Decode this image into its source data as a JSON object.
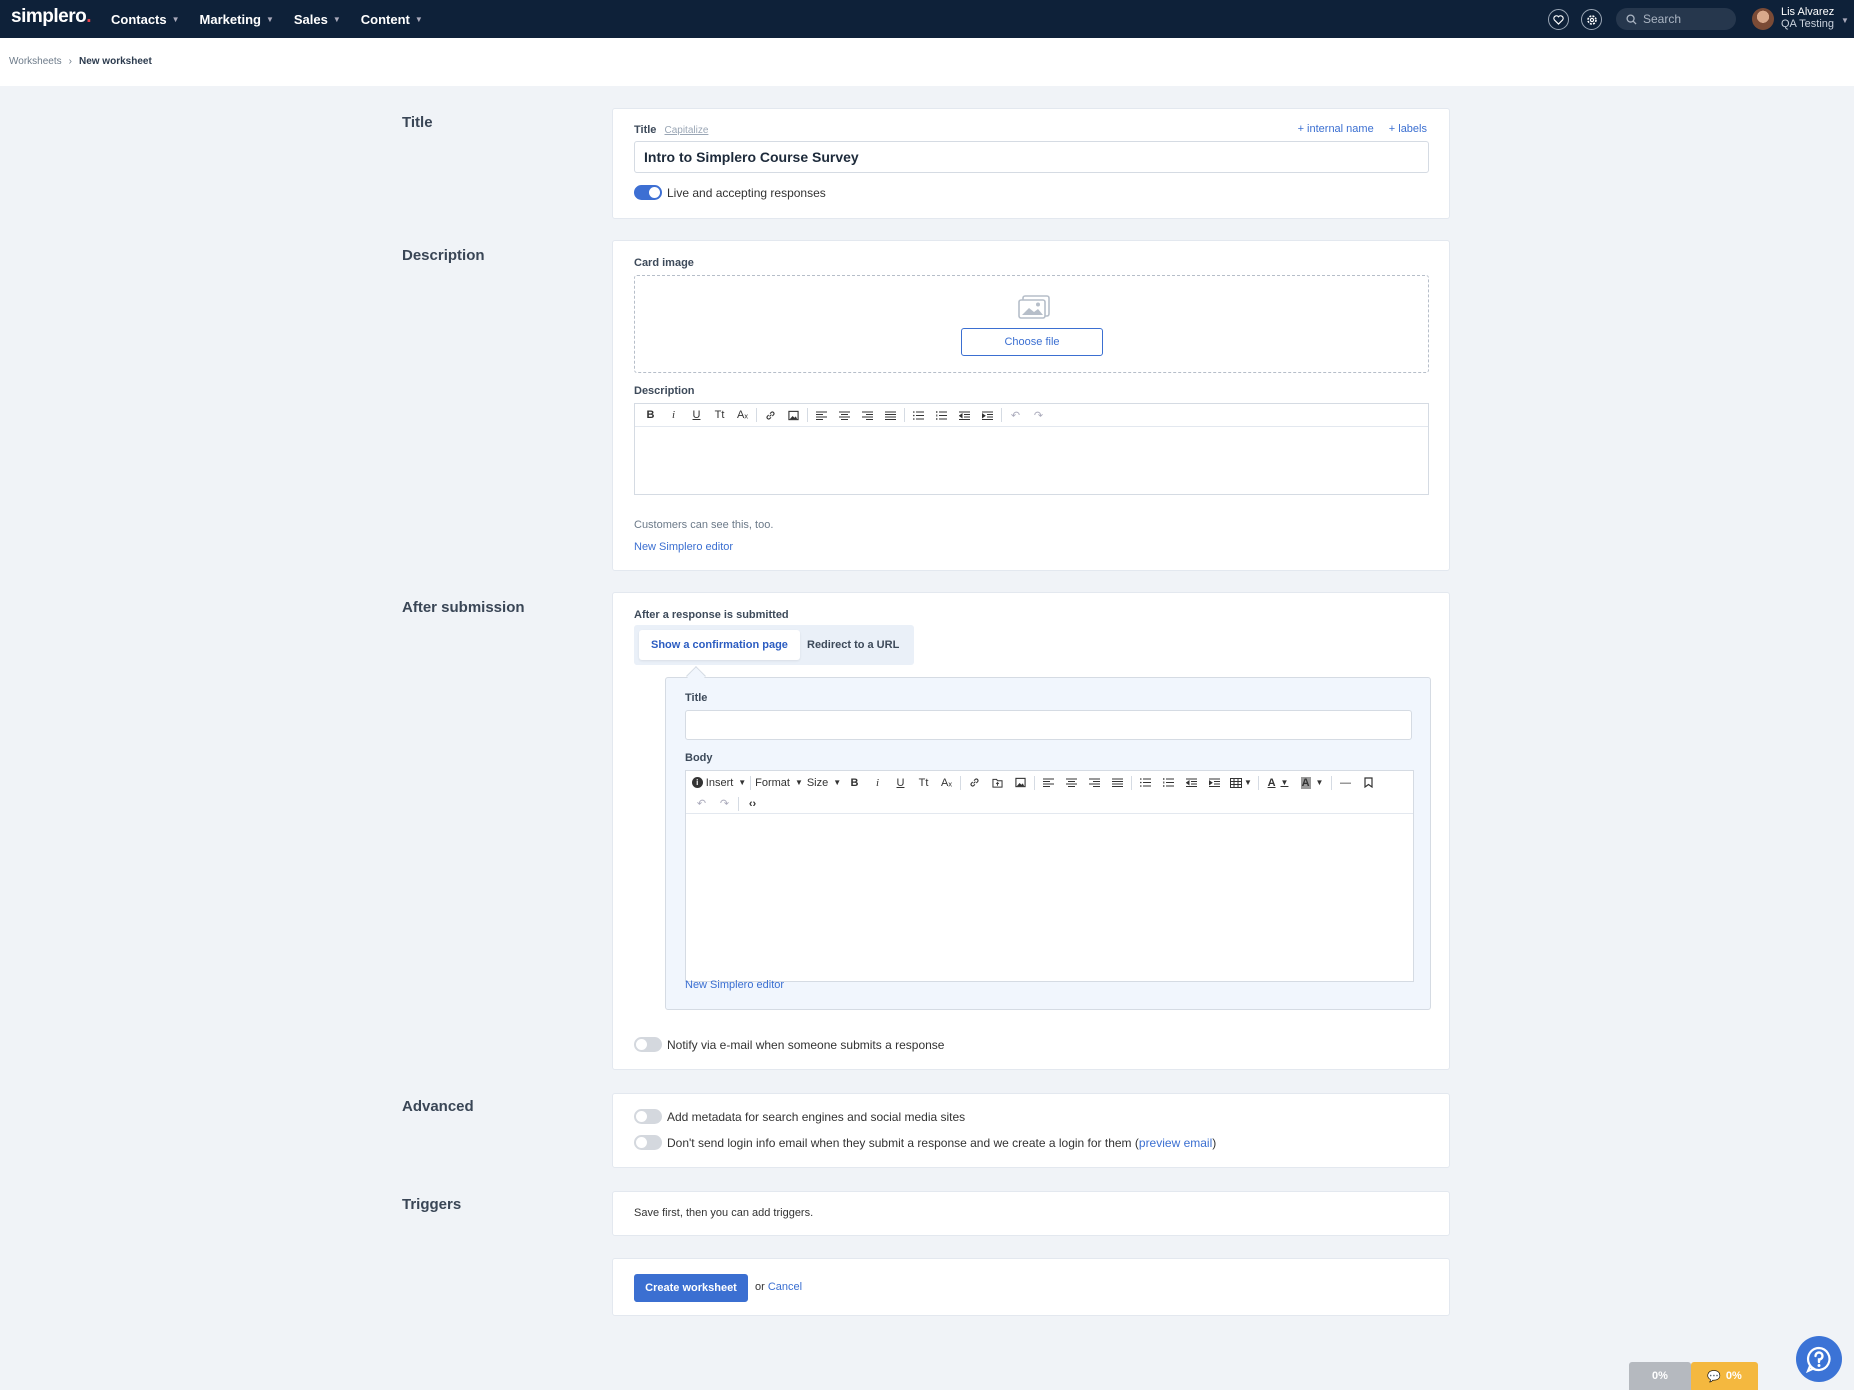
{
  "brand": {
    "name": "simplero",
    "dot": "."
  },
  "nav": [
    {
      "label": "Contacts"
    },
    {
      "label": "Marketing"
    },
    {
      "label": "Sales"
    },
    {
      "label": "Content"
    }
  ],
  "search": {
    "placeholder": "Search"
  },
  "user": {
    "name": "Lis Alvarez",
    "org": "QA Testing"
  },
  "breadcrumb": {
    "parent": "Worksheets",
    "current": "New worksheet"
  },
  "sections": {
    "title": "Title",
    "description": "Description",
    "after_submission": "After submission",
    "advanced": "Advanced",
    "triggers": "Triggers"
  },
  "title_card": {
    "label": "Title",
    "capitalize": "Capitalize",
    "internal_name": "+ internal name",
    "labels": "+ labels",
    "value": "Intro to Simplero Course Survey",
    "live_label": "Live and accepting responses",
    "live_on": true
  },
  "description_card": {
    "card_image_label": "Card image",
    "choose_file": "Choose file",
    "description_label": "Description",
    "hint": "Customers can see this, too.",
    "new_editor": "New Simplero editor",
    "toolbar": {
      "bold": "B",
      "italic": "i",
      "underline": "U",
      "size": "Tt",
      "clear": "Aₓ"
    }
  },
  "after_submission_card": {
    "label": "After a response is submitted",
    "tab_confirm": "Show a confirmation page",
    "tab_redirect": "Redirect to a URL",
    "confirm_title_label": "Title",
    "confirm_title_value": "",
    "body_label": "Body",
    "toolbar": {
      "insert": "Insert",
      "format": "Format",
      "size": "Size",
      "bold": "B",
      "italic": "i",
      "underline": "U",
      "tt": "Tt",
      "clear": "Aₓ"
    },
    "new_editor": "New Simplero editor",
    "notify_label": "Notify via e-mail when someone submits a response"
  },
  "advanced_card": {
    "metadata_label": "Add metadata for search engines and social media sites",
    "login_label_pre": "Don't send login info email when they submit a response and we create a login for them (",
    "login_link": "preview email",
    "login_label_post": ")"
  },
  "triggers_card": {
    "text": "Save first, then you can add triggers."
  },
  "actions": {
    "create": "Create worksheet",
    "or": "or",
    "cancel": "Cancel"
  },
  "badges": {
    "progress_a": "0%",
    "progress_b": "0%"
  },
  "colors": {
    "topbar": "#0e2139",
    "accent": "#3b6fd1",
    "badge_gray": "#b5b9bf",
    "badge_yellow": "#f4b83f"
  }
}
